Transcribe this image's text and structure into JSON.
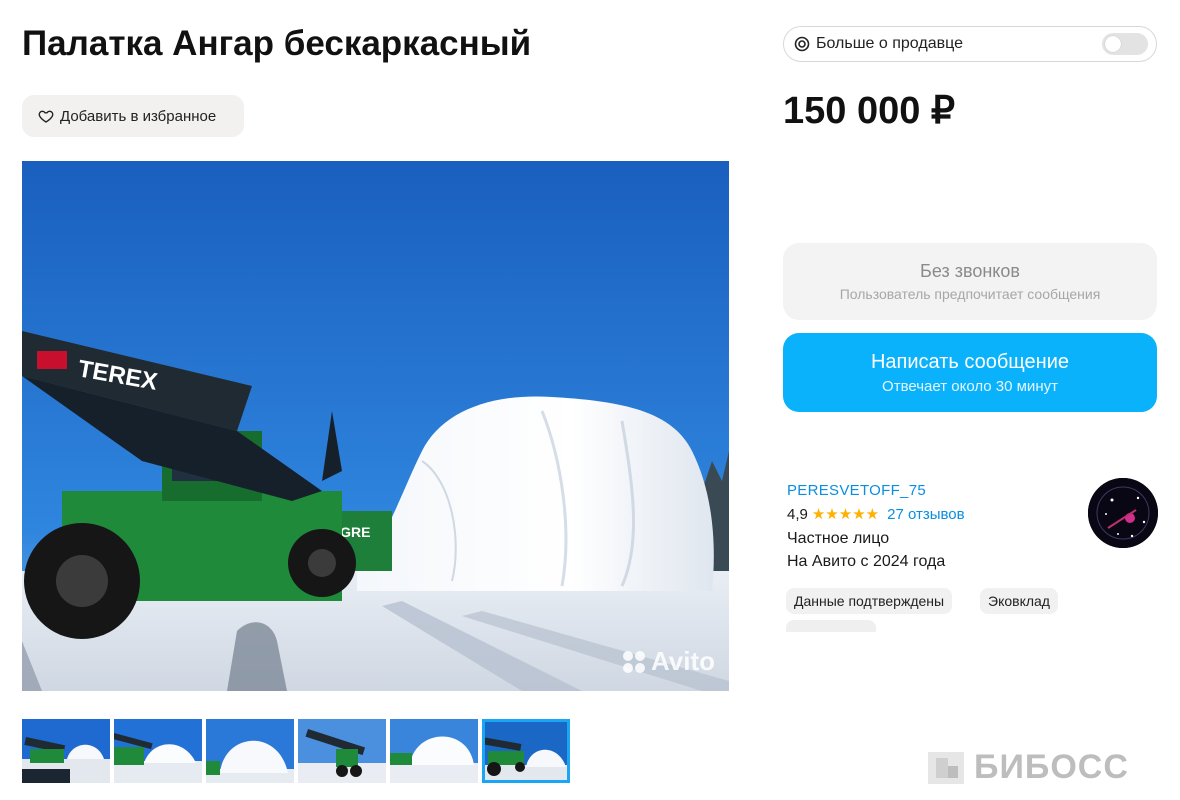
{
  "listing": {
    "title": "Палатка Ангар бескаркасный",
    "favorite_label": "Добавить в избранное",
    "price": "150 000 ₽"
  },
  "photo": {
    "watermark": "Avito",
    "crane_brand": "TEREX",
    "thumbnails_count": 6,
    "active_thumbnail": 6
  },
  "seller_toggle": {
    "label": "Больше о продавце",
    "enabled": false
  },
  "contact": {
    "no_calls_title": "Без звонков",
    "no_calls_subtitle": "Пользователь предпочитает сообщения",
    "message_button": "Написать сообщение",
    "message_subtitle": "Отвечает около 30 минут"
  },
  "seller": {
    "name": "PERESVETOFF_75",
    "rating": "4,9",
    "stars": "★★★★★",
    "reviews": "27 отзывов",
    "type": "Частное лицо",
    "since": "На Авито с 2024 года",
    "badges": [
      "Данные подтверждены",
      "Эковклад"
    ]
  },
  "brand": {
    "name": "БИБОСС"
  },
  "colors": {
    "accent": "#0ab2fb",
    "link": "#0a8ee0",
    "star": "#ffb000",
    "sky": "#1b67c6",
    "vehicle_green": "#1f8a3a"
  }
}
